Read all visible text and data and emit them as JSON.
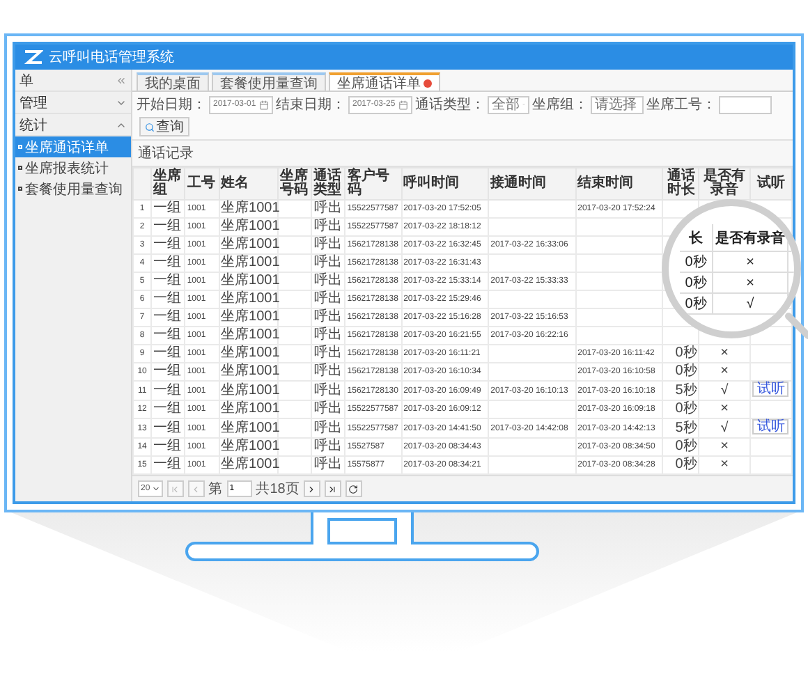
{
  "window": {
    "title": "云呼叫电话管理系统"
  },
  "sidebar": {
    "items": [
      {
        "kind": "header",
        "label": "单"
      },
      {
        "kind": "group",
        "label": "管理",
        "expanded": false
      },
      {
        "kind": "group",
        "label": "统计",
        "expanded": true,
        "children": [
          {
            "label": "坐席通话详单",
            "selected": true
          },
          {
            "label": "坐席报表统计",
            "selected": false
          },
          {
            "label": "套餐使用量查询",
            "selected": false
          }
        ]
      }
    ]
  },
  "tabs": [
    {
      "label": "我的桌面",
      "selected": false,
      "closable": false
    },
    {
      "label": "套餐使用量查询",
      "selected": false,
      "closable": false
    },
    {
      "label": "坐席通话详单",
      "selected": true,
      "closable": true
    }
  ],
  "filters": [
    {
      "kind": "date",
      "label": "开始日期：",
      "value": "2017-03-01"
    },
    {
      "kind": "date",
      "label": "结束日期：",
      "value": "2017-03-25"
    },
    {
      "kind": "select",
      "label": "通话类型：",
      "value": "全部"
    },
    {
      "kind": "select",
      "label": "坐席组：",
      "value": "请选择"
    },
    {
      "kind": "text",
      "label": "坐席工号："
    }
  ],
  "search_button": "查询",
  "section_title": "通话记录",
  "table": {
    "columns": [
      "坐席组",
      "工号",
      "姓名",
      "坐席号码",
      "通话类型",
      "客户号码",
      "呼叫时间",
      "接通时间",
      "结束时间",
      "通话时长",
      "是否有录音",
      "试听"
    ],
    "rows": [
      {
        "no": "1",
        "group": "一组",
        "agent_id": "1001",
        "name": "坐席1001",
        "type": "呼出",
        "customer": "15522577587",
        "call_time": "2017-03-20 17:52:05",
        "end_time": "2017-03-20 17:52:24"
      },
      {
        "no": "2",
        "group": "一组",
        "agent_id": "1001",
        "name": "坐席1001",
        "type": "呼出",
        "customer": "15522577587",
        "call_time": "2017-03-22 18:18:12"
      },
      {
        "no": "3",
        "group": "一组",
        "agent_id": "1001",
        "name": "坐席1001",
        "type": "呼出",
        "customer": "15621728138",
        "call_time": "2017-03-22 16:32:45",
        "answer_time": "2017-03-22 16:33:06"
      },
      {
        "no": "4",
        "group": "一组",
        "agent_id": "1001",
        "name": "坐席1001",
        "type": "呼出",
        "customer": "15621728138",
        "call_time": "2017-03-22 16:31:43"
      },
      {
        "no": "5",
        "group": "一组",
        "agent_id": "1001",
        "name": "坐席1001",
        "type": "呼出",
        "customer": "15621728138",
        "call_time": "2017-03-22 15:33:14",
        "answer_time": "2017-03-22 15:33:33"
      },
      {
        "no": "6",
        "group": "一组",
        "agent_id": "1001",
        "name": "坐席1001",
        "type": "呼出",
        "customer": "15621728138",
        "call_time": "2017-03-22 15:29:46"
      },
      {
        "no": "7",
        "group": "一组",
        "agent_id": "1001",
        "name": "坐席1001",
        "type": "呼出",
        "customer": "15621728138",
        "call_time": "2017-03-22 15:16:28",
        "answer_time": "2017-03-22 15:16:53"
      },
      {
        "no": "8",
        "group": "一组",
        "agent_id": "1001",
        "name": "坐席1001",
        "type": "呼出",
        "customer": "15621728138",
        "call_time": "2017-03-20 16:21:55",
        "answer_time": "2017-03-20 16:22:16"
      },
      {
        "no": "9",
        "group": "一组",
        "agent_id": "1001",
        "name": "坐席1001",
        "type": "呼出",
        "customer": "15621728138",
        "call_time": "2017-03-20 16:11:21",
        "end_time": "2017-03-20 16:11:42",
        "duration": "0秒",
        "recorded": "×"
      },
      {
        "no": "10",
        "group": "一组",
        "agent_id": "1001",
        "name": "坐席1001",
        "type": "呼出",
        "customer": "15621728138",
        "call_time": "2017-03-20 16:10:34",
        "end_time": "2017-03-20 16:10:58",
        "duration": "0秒",
        "recorded": "×"
      },
      {
        "no": "11",
        "group": "一组",
        "agent_id": "1001",
        "name": "坐席1001",
        "type": "呼出",
        "customer": "15621728130",
        "call_time": "2017-03-20 16:09:49",
        "answer_time": "2017-03-20 16:10:13",
        "end_time": "2017-03-20 16:10:18",
        "duration": "5秒",
        "recorded": "√",
        "listen": "试听"
      },
      {
        "no": "12",
        "group": "一组",
        "agent_id": "1001",
        "name": "坐席1001",
        "type": "呼出",
        "customer": "15522577587",
        "call_time": "2017-03-20 16:09:12",
        "end_time": "2017-03-20 16:09:18",
        "duration": "0秒",
        "recorded": "×"
      },
      {
        "no": "13",
        "group": "一组",
        "agent_id": "1001",
        "name": "坐席1001",
        "type": "呼出",
        "customer": "15522577587",
        "call_time": "2017-03-20 14:41:50",
        "answer_time": "2017-03-20 14:42:08",
        "end_time": "2017-03-20 14:42:13",
        "duration": "5秒",
        "recorded": "√",
        "listen": "试听"
      },
      {
        "no": "14",
        "group": "一组",
        "agent_id": "1001",
        "name": "坐席1001",
        "type": "呼出",
        "customer": "15527587",
        "call_time": "2017-03-20 08:34:43",
        "end_time": "2017-03-20 08:34:50",
        "duration": "0秒",
        "recorded": "×"
      },
      {
        "no": "15",
        "group": "一组",
        "agent_id": "1001",
        "name": "坐席1001",
        "type": "呼出",
        "customer": "15575877",
        "call_time": "2017-03-20 08:34:21",
        "end_time": "2017-03-20 08:34:28",
        "duration": "0秒",
        "recorded": "×"
      }
    ]
  },
  "pager": {
    "page_size": "20",
    "page_prefix": "第",
    "page": "1",
    "page_total": "共18页"
  },
  "magnifier": {
    "headers": [
      "长",
      "是否有录音"
    ],
    "rows": [
      {
        "duration": "0秒",
        "recorded": "×"
      },
      {
        "duration": "0秒",
        "recorded": "×"
      },
      {
        "duration": "0秒",
        "recorded": "√"
      }
    ]
  }
}
